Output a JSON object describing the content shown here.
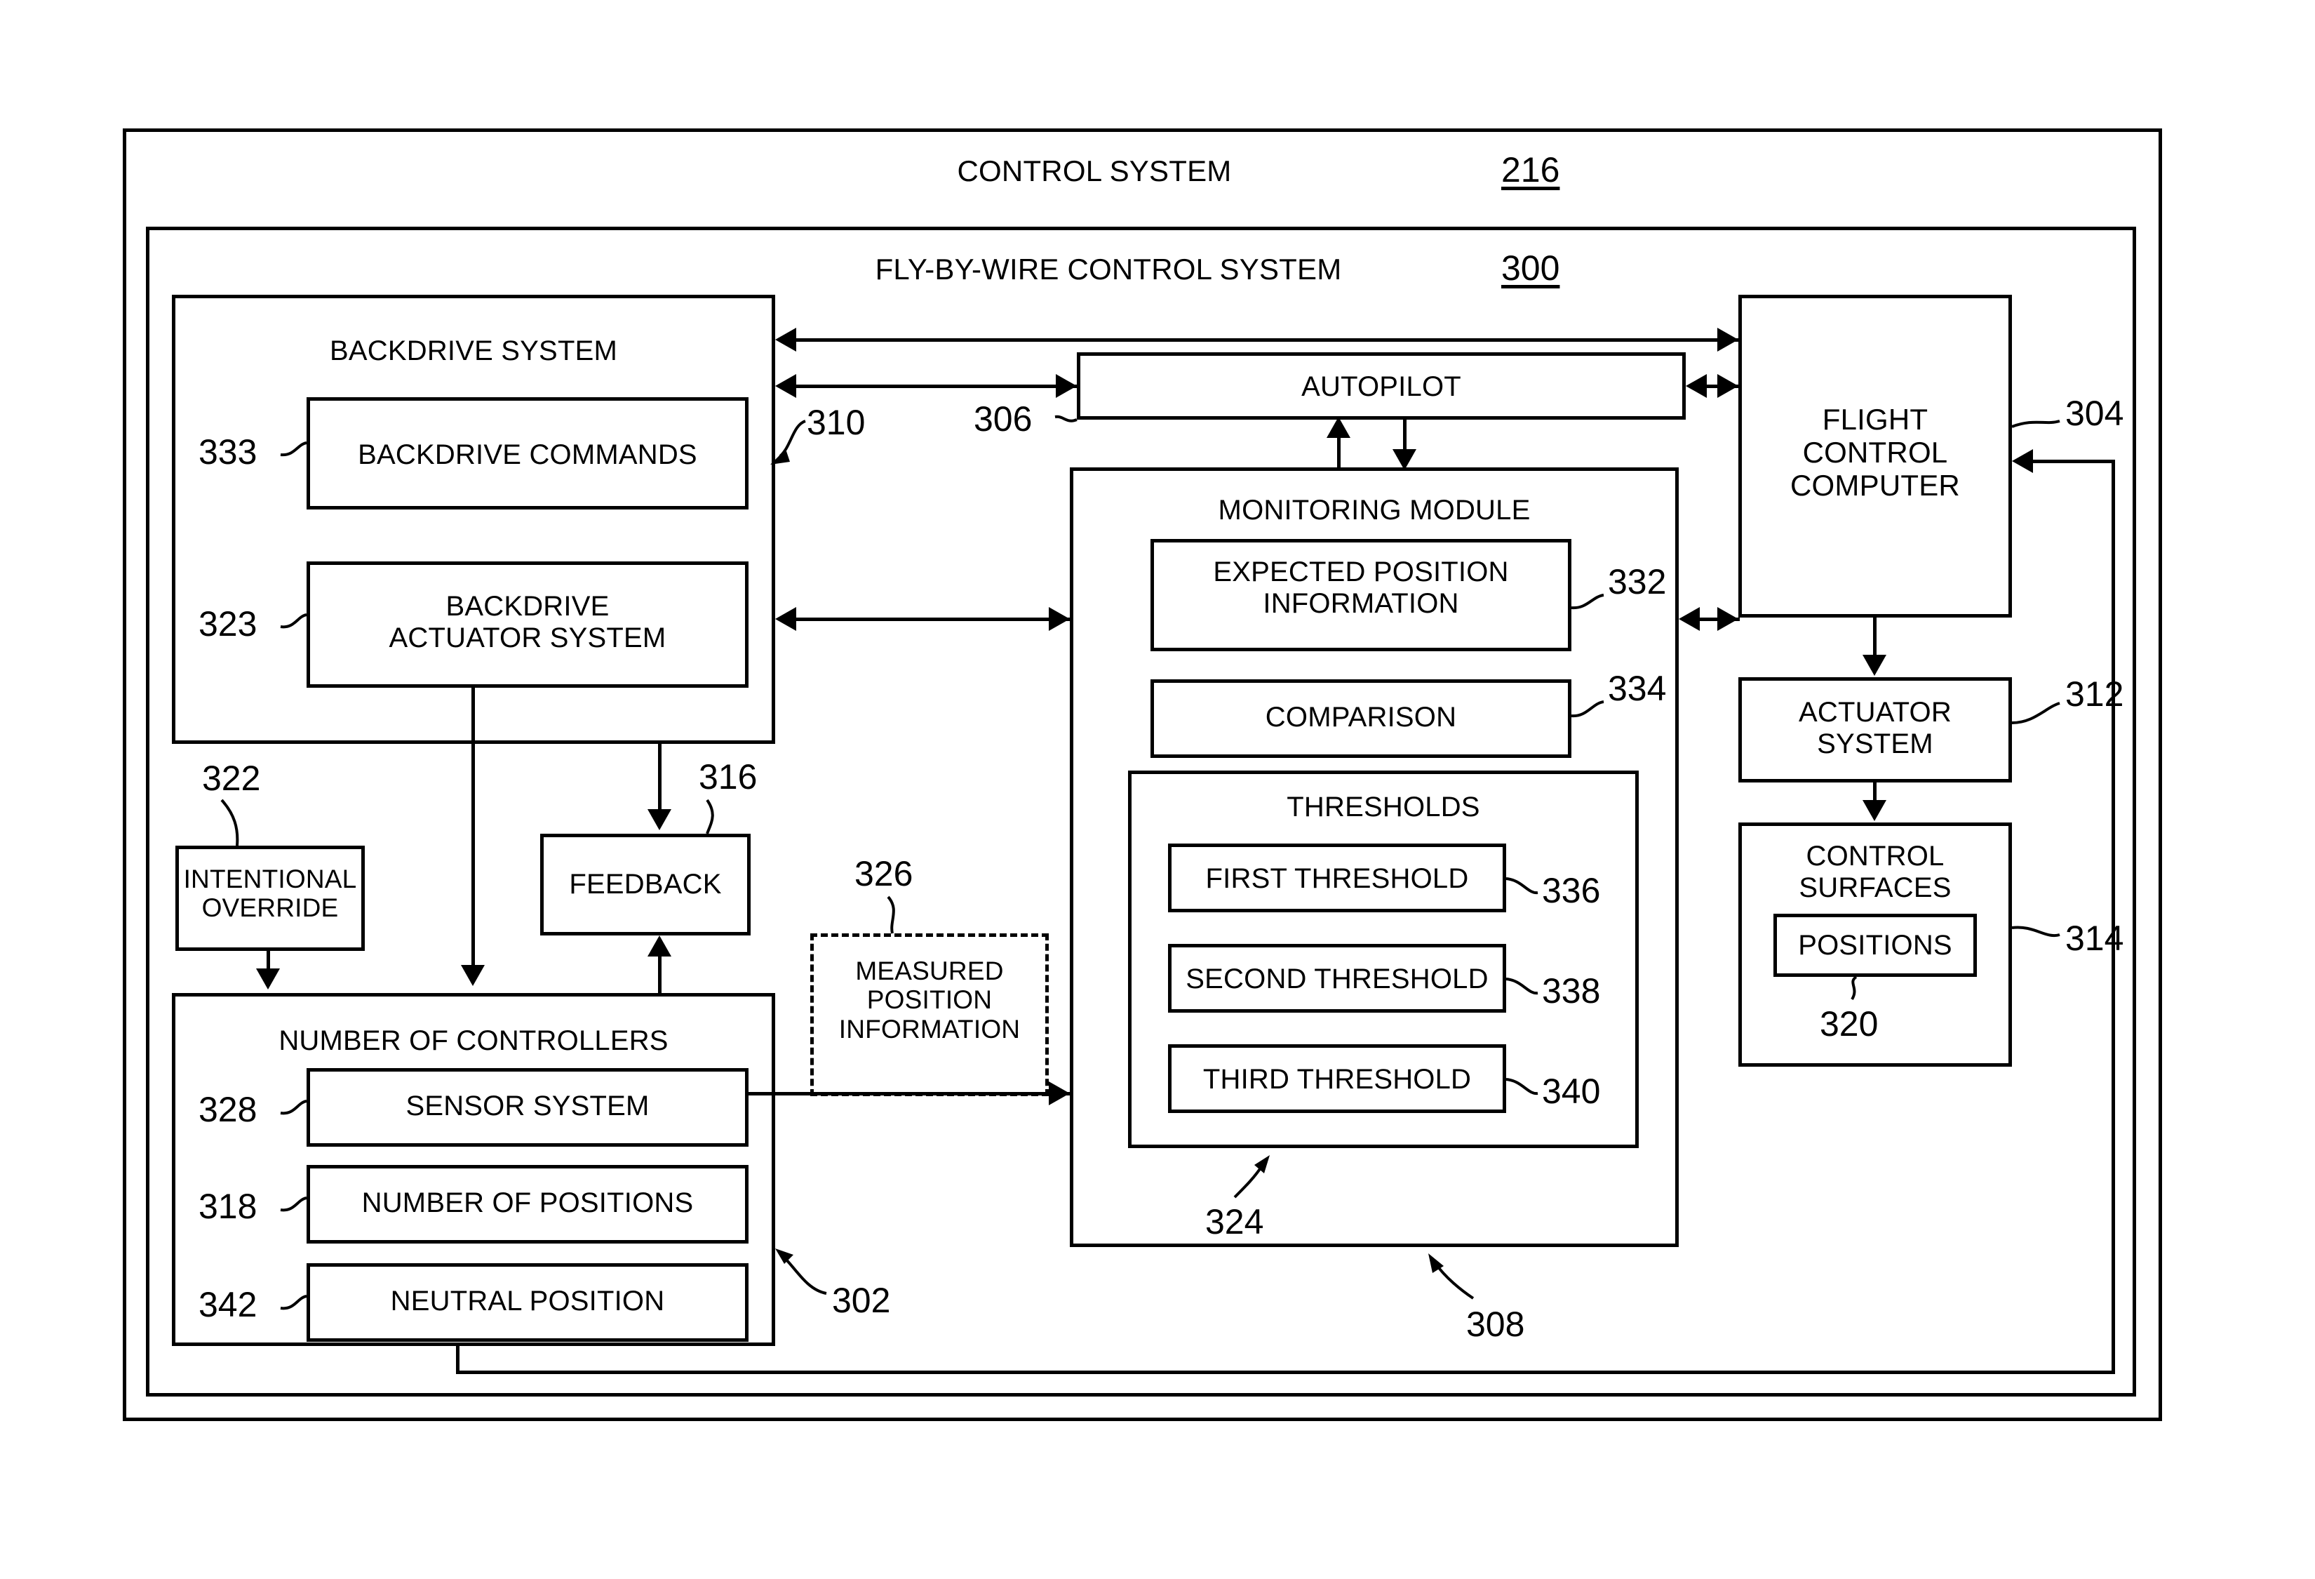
{
  "figure": {
    "outer_title": "CONTROL SYSTEM",
    "outer_ref": "216",
    "inner_title": "FLY-BY-WIRE CONTROL SYSTEM",
    "inner_ref": "300"
  },
  "blocks": {
    "backdrive_system": {
      "label": "BACKDRIVE SYSTEM"
    },
    "backdrive_commands": {
      "label": "BACKDRIVE COMMANDS",
      "ref": "333"
    },
    "backdrive_actuator_system": {
      "label": "BACKDRIVE\nACTUATOR SYSTEM",
      "ref": "323"
    },
    "intentional_override": {
      "label": "INTENTIONAL\nOVERRIDE",
      "ref": "322"
    },
    "feedback": {
      "label": "FEEDBACK",
      "ref": "316"
    },
    "measured_position_information": {
      "label": "MEASURED\nPOSITION\nINFORMATION",
      "ref": "326"
    },
    "number_of_controllers": {
      "label": "NUMBER OF CONTROLLERS",
      "ref": "302"
    },
    "sensor_system": {
      "label": "SENSOR SYSTEM",
      "ref": "328"
    },
    "number_of_positions": {
      "label": "NUMBER OF POSITIONS",
      "ref": "318"
    },
    "neutral_position": {
      "label": "NEUTRAL POSITION",
      "ref": "342"
    },
    "autopilot": {
      "label": "AUTOPILOT",
      "ref": "306"
    },
    "monitoring_module": {
      "label": "MONITORING MODULE",
      "ref": "308"
    },
    "expected_position_information": {
      "label": "EXPECTED POSITION\nINFORMATION",
      "ref": "332"
    },
    "comparison": {
      "label": "COMPARISON",
      "ref": "334"
    },
    "thresholds": {
      "label": "THRESHOLDS",
      "ref": "324"
    },
    "first_threshold": {
      "label": "FIRST THRESHOLD",
      "ref": "336"
    },
    "second_threshold": {
      "label": "SECOND THRESHOLD",
      "ref": "338"
    },
    "third_threshold": {
      "label": "THIRD THRESHOLD",
      "ref": "340"
    },
    "flight_control_computer": {
      "label": "FLIGHT\nCONTROL\nCOMPUTER",
      "ref": "304"
    },
    "actuator_system": {
      "label": "ACTUATOR\nSYSTEM",
      "ref": "312"
    },
    "control_surfaces": {
      "label": "CONTROL\nSURFACES",
      "ref": "314"
    },
    "positions": {
      "label": "POSITIONS",
      "ref": "320"
    }
  },
  "connector_refs": {
    "backdrive_link": "310"
  },
  "colors": {
    "stroke": "#000000",
    "background": "#ffffff"
  }
}
